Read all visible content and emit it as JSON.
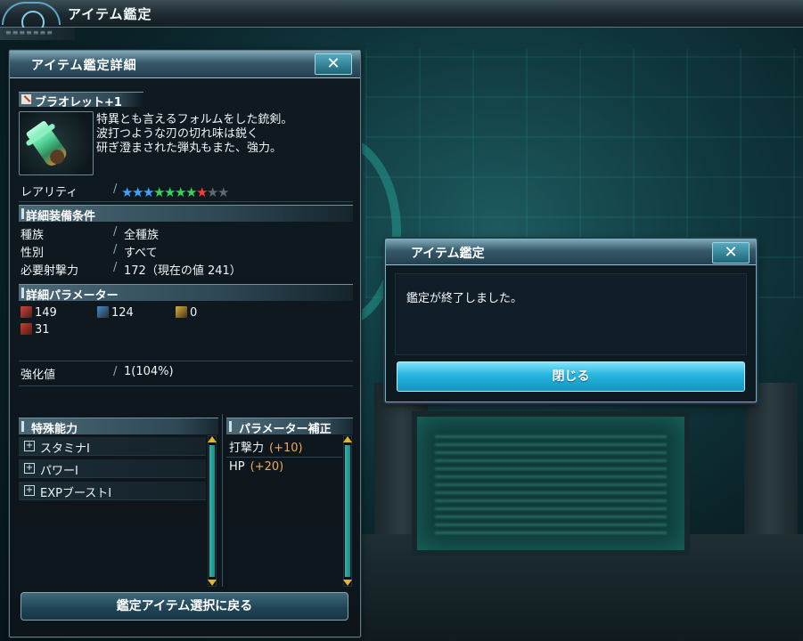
{
  "topbar": {
    "title": "アイテム鑑定"
  },
  "window": {
    "title": "アイテム鑑定詳細",
    "close_glyph": "✕",
    "item_name": "ブラオレット+1",
    "description": [
      "特異とも言えるフォルムをした銃剣。",
      "波打つような刃の切れ味は鋭く",
      "研ぎ澄まされた弾丸もまた、強力。"
    ],
    "rarity": {
      "label": "レアリティ",
      "filled": 8,
      "total": 10,
      "star_colors": [
        "#3fa4ff",
        "#3fa4ff",
        "#3fa4ff",
        "#35d45a",
        "#35d45a",
        "#35d45a",
        "#35d45a",
        "#ff3b2f",
        "#5d6a70",
        "#5d6a70"
      ]
    },
    "requirements": {
      "header": "詳細装備条件",
      "rows": [
        {
          "key": "種族",
          "value": "全種族"
        },
        {
          "key": "性別",
          "value": "すべて"
        },
        {
          "key": "必要射撃力",
          "value": "172（現在の値 241）"
        }
      ]
    },
    "params": {
      "header": "詳細パラメーター",
      "stats": [
        {
          "icon": "striking-attack-icon",
          "value": "149",
          "color": "#d3443a"
        },
        {
          "icon": "ranged-attack-icon",
          "value": "124",
          "color": "#3f8fd2"
        },
        {
          "icon": "technique-attack-icon",
          "value": "0",
          "color": "#d8b13a"
        },
        {
          "icon": "element-fire-icon",
          "value": "31",
          "color": "#d8372c"
        }
      ]
    },
    "grind": {
      "key": "強化値",
      "value": "1(104%)"
    },
    "abilities": {
      "header": "特殊能力",
      "items": [
        "スタミナI",
        "パワーI",
        "EXPブーストI"
      ]
    },
    "bonus": {
      "header": "パラメーター補正",
      "items": [
        {
          "name": "打撃力",
          "value": "(+10)"
        },
        {
          "name": "HP",
          "value": "(+20)"
        }
      ]
    },
    "back_button": "鑑定アイテム選択に戻る"
  },
  "dialog": {
    "title": "アイテム鑑定",
    "close_glyph": "✕",
    "message": "鑑定が終了しました。",
    "close_button": "閉じる"
  }
}
